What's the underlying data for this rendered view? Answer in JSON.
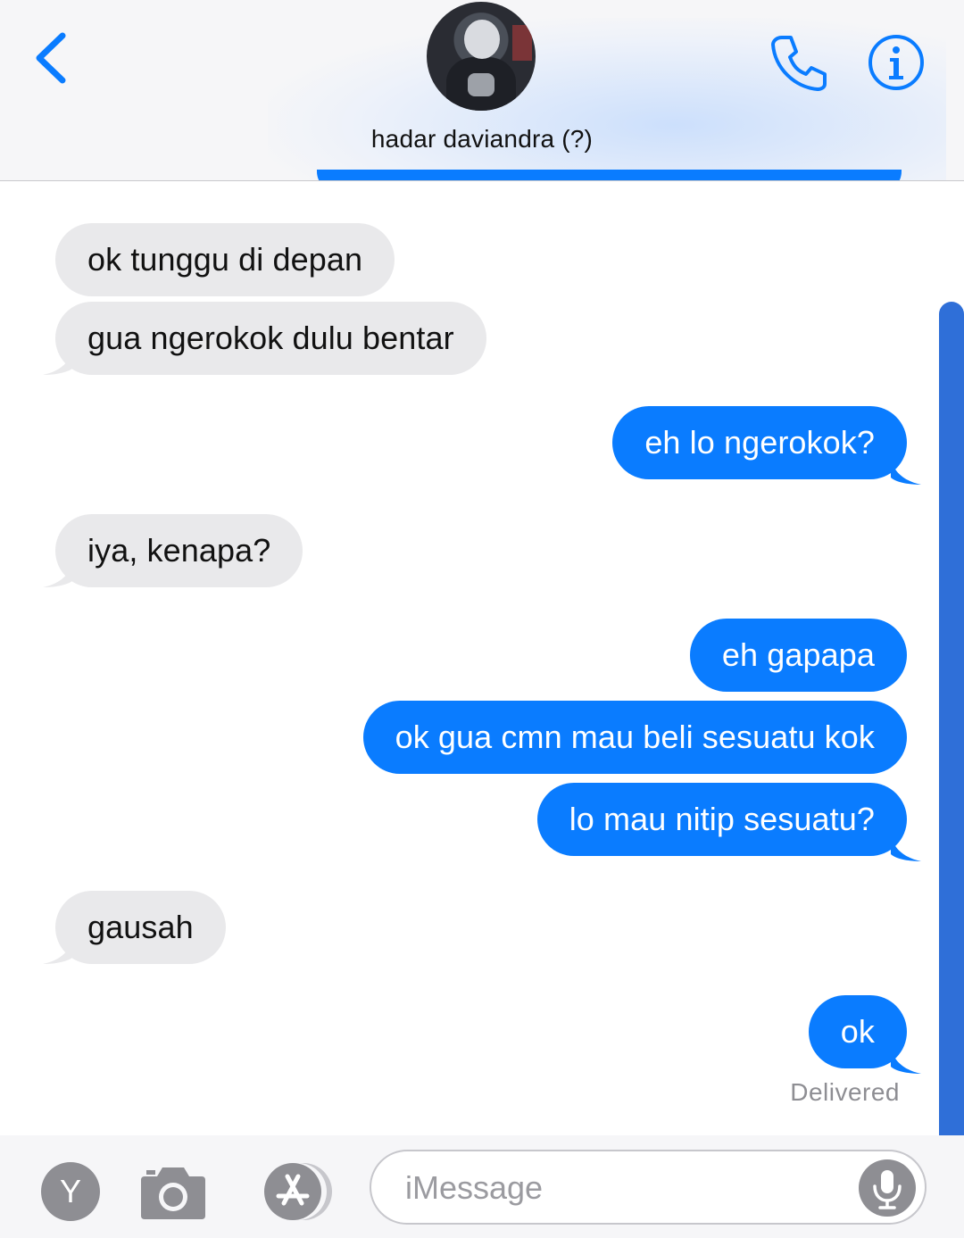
{
  "header": {
    "contact_name": "hadar daviandra (?)",
    "accent_color": "#0a7cff",
    "back_icon": "chevron-left-icon",
    "call_icon": "phone-icon",
    "info_icon": "info-icon"
  },
  "messages": [
    {
      "direction": "incoming",
      "text": "ok tunggu di depan"
    },
    {
      "direction": "incoming",
      "text": "gua ngerokok dulu bentar"
    },
    {
      "direction": "outgoing",
      "text": "eh lo ngerokok?"
    },
    {
      "direction": "incoming",
      "text": "iya, kenapa?"
    },
    {
      "direction": "outgoing",
      "text": "eh gapapa"
    },
    {
      "direction": "outgoing",
      "text": "ok gua cmn mau beli sesuatu kok"
    },
    {
      "direction": "outgoing",
      "text": "lo mau nitip sesuatu?"
    },
    {
      "direction": "incoming",
      "text": "gausah"
    },
    {
      "direction": "outgoing",
      "text": "ok"
    }
  ],
  "status": {
    "delivered": "Delivered"
  },
  "composer": {
    "y_button_label": "Y",
    "camera_icon": "camera-icon",
    "app_store_icon": "app-store-icon",
    "placeholder": "iMessage",
    "mic_icon": "microphone-icon"
  },
  "colors": {
    "incoming_bubble": "#e9e9eb",
    "outgoing_bubble": "#0a7cff",
    "secondary_text": "#8e8e93"
  }
}
